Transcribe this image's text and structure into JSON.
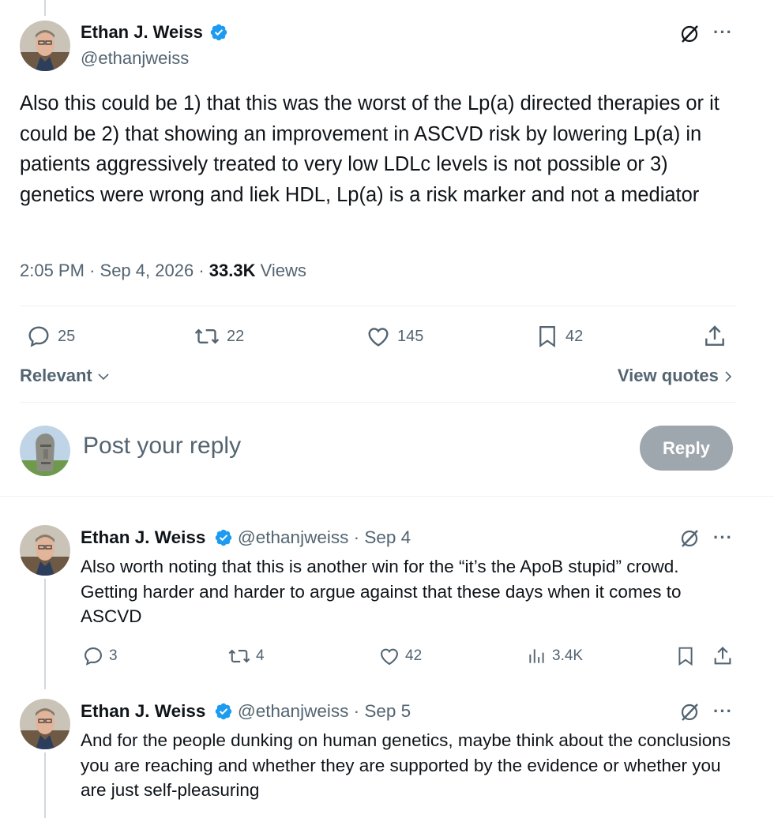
{
  "main_tweet": {
    "author_name": "Ethan J. Weiss",
    "handle": "@ethanjweiss",
    "text": "Also this could be 1) that this was the worst of the Lp(a) directed therapies or it could be 2) that showing an improvement in ASCVD risk by lowering Lp(a) in patients aggressively treated to very low LDLc levels is not possible or 3) genetics were wrong and liek HDL, Lp(a) is a risk marker and not a mediator",
    "time": "2:05 PM",
    "sep1": "·",
    "date": "Sep 4, 2026",
    "sep2": "·",
    "views_count": "33.3K",
    "views_label": "Views",
    "replies": "25",
    "retweets": "22",
    "likes": "145",
    "bookmarks": "42"
  },
  "sort": {
    "label": "Relevant",
    "view_quotes": "View quotes"
  },
  "composer": {
    "placeholder": "Post your reply",
    "reply_button": "Reply"
  },
  "replies": [
    {
      "author_name": "Ethan J. Weiss",
      "handle_date": "@ethanjweiss · Sep 4",
      "text": "Also worth noting that this is another win for the “it’s the ApoB stupid” crowd. Getting harder and harder to argue against that these days when it comes to ASCVD",
      "replies": "3",
      "retweets": "4",
      "likes": "42",
      "views": "3.4K"
    },
    {
      "author_name": "Ethan J. Weiss",
      "handle_date": "@ethanjweiss · Sep 5",
      "text": "And for the people dunking on human genetics, maybe think about the conclusions you are reaching and whether they are supported by the evidence or whether you are just self-pleasuring"
    }
  ],
  "colors": {
    "verified": "#1d9bf0",
    "muted": "#536471",
    "text": "#0f1419",
    "divider": "#eff3f4"
  },
  "icons": [
    "verified-badge-icon",
    "grok-icon",
    "more-icon",
    "reply-icon",
    "retweet-icon",
    "like-icon",
    "bookmark-icon",
    "share-icon",
    "views-icon",
    "chevron-down-icon",
    "chevron-right-icon"
  ]
}
